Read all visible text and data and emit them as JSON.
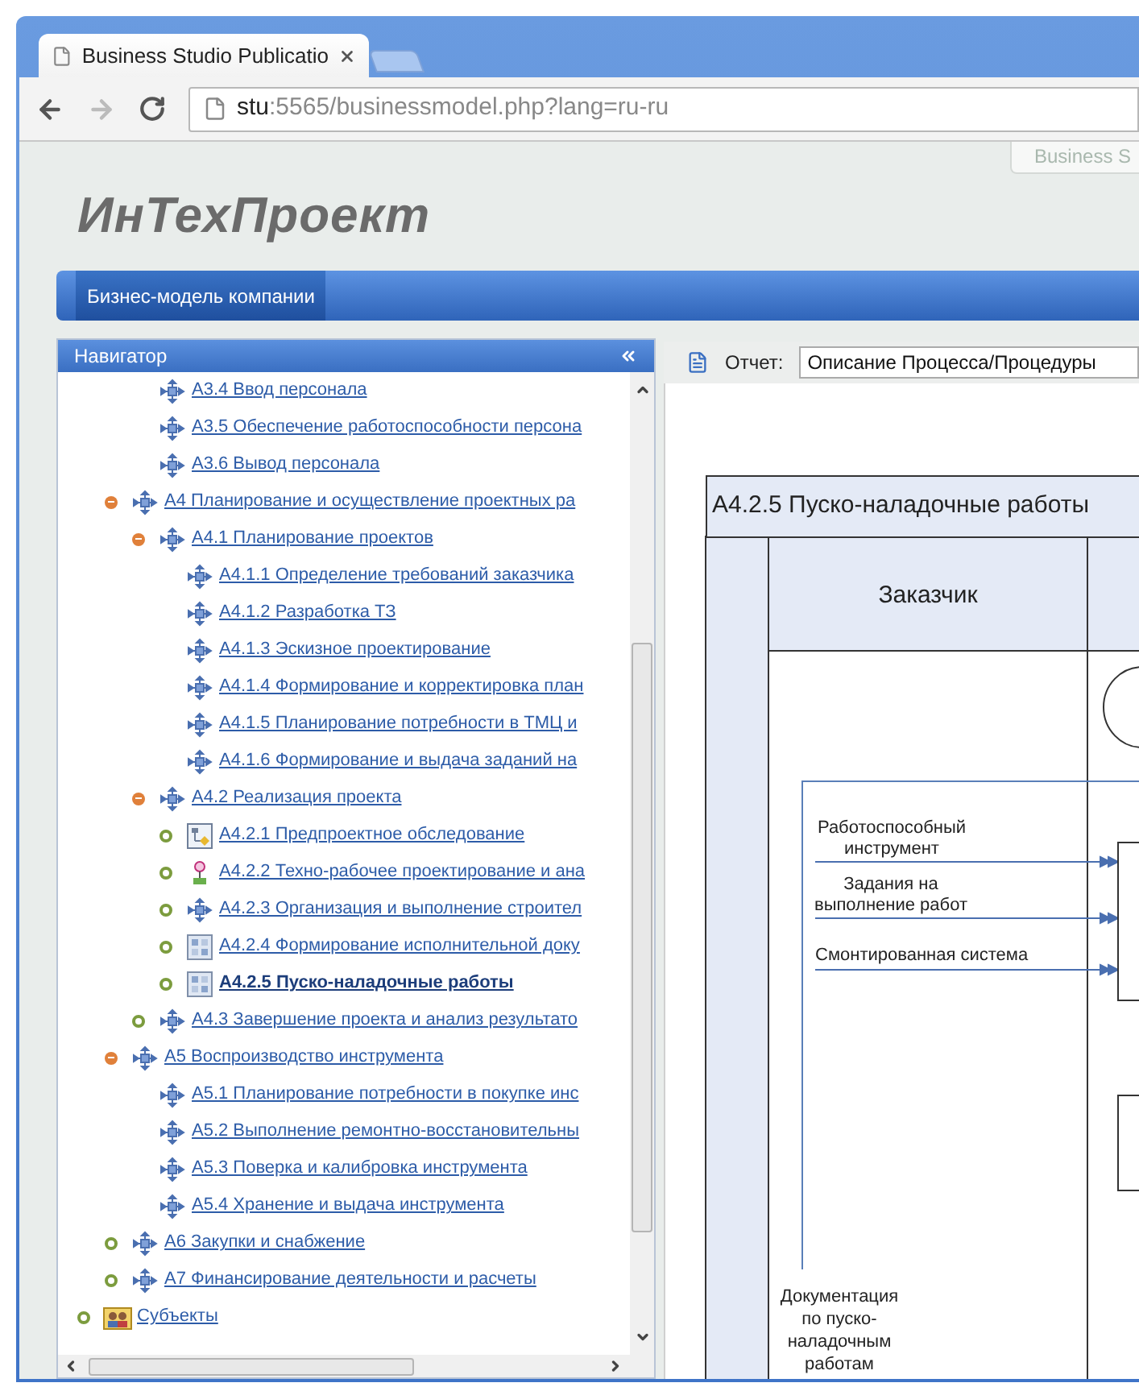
{
  "browser": {
    "tab": {
      "title": "Business Studio Publicatio"
    },
    "url": {
      "host": "stu",
      "rest": ":5565/businessmodel.php?lang=ru-ru"
    }
  },
  "header": {
    "corner_tab": "Business S",
    "logo": "ИнТехПроект"
  },
  "menu": [
    {
      "label": "Бизнес-модель компании",
      "selected": true
    }
  ],
  "navigator": {
    "title": "Навигатор",
    "tree": [
      {
        "children": [
          {
            "children": [
              {
                "label": "А3.4 Ввод персонала",
                "kind": "process",
                "selected": false
              },
              {
                "label": "А3.5 Обеспечение работоспособности персона",
                "kind": "process",
                "selected": false
              },
              {
                "label": "А3.6 Вывод персонала",
                "kind": "process",
                "selected": false
              }
            ]
          },
          {
            "label": "А4 Планирование и осуществление проектных ра",
            "kind": "process",
            "expanded": true,
            "selected": false,
            "children": [
              {
                "label": "А4.1 Планирование проектов",
                "kind": "process",
                "expanded": true,
                "selected": false,
                "children": [
                  {
                    "label": "А4.1.1 Определение требований заказчика",
                    "kind": "process",
                    "selected": false
                  },
                  {
                    "label": "А4.1.2 Разработка ТЗ",
                    "kind": "process",
                    "selected": false
                  },
                  {
                    "label": "А4.1.3 Эскизное проектирование",
                    "kind": "process",
                    "selected": false
                  },
                  {
                    "label": "А4.1.4 Формирование и корректировка план",
                    "kind": "process",
                    "selected": false
                  },
                  {
                    "label": "А4.1.5 Планирование потребности в ТМЦ и",
                    "kind": "process",
                    "selected": false
                  },
                  {
                    "label": "А4.1.6 Формирование и выдача заданий на",
                    "kind": "process",
                    "selected": false
                  }
                ]
              },
              {
                "label": "А4.2 Реализация проекта",
                "kind": "process",
                "expanded": true,
                "selected": false,
                "children": [
                  {
                    "label": "А4.2.1 Предпроектное обследование",
                    "kind": "diagram",
                    "expanded": false,
                    "selected": false
                  },
                  {
                    "label": "А4.2.2 Техно-рабочее проектирование и ана",
                    "kind": "node",
                    "expanded": false,
                    "selected": false
                  },
                  {
                    "label": "А4.2.3 Организация и выполнение строител",
                    "kind": "process",
                    "expanded": false,
                    "selected": false
                  },
                  {
                    "label": "А4.2.4 Формирование исполнительной доку",
                    "kind": "table",
                    "expanded": false,
                    "selected": false
                  },
                  {
                    "label": "А4.2.5 Пуско-наладочные работы",
                    "kind": "table",
                    "expanded": false,
                    "selected": true
                  }
                ]
              },
              {
                "label": "А4.3 Завершение проекта и анализ результато",
                "kind": "process",
                "expanded": false,
                "selected": false
              }
            ]
          },
          {
            "label": "А5 Воспроизводство инструмента",
            "kind": "process",
            "expanded": true,
            "selected": false,
            "children": [
              {
                "label": "А5.1 Планирование потребности в покупке инс",
                "kind": "process",
                "selected": false
              },
              {
                "label": "А5.2 Выполнение ремонтно-восстановительны",
                "kind": "process",
                "selected": false
              },
              {
                "label": "А5.3 Поверка и калибровка инструмента",
                "kind": "process",
                "selected": false
              },
              {
                "label": "А5.4 Хранение и выдача инструмента",
                "kind": "process",
                "selected": false
              }
            ]
          },
          {
            "label": "А6 Закупки и снабжение",
            "kind": "process",
            "expanded": false,
            "selected": false
          },
          {
            "label": "А7 Финансирование деятельности и расчеты",
            "kind": "process",
            "expanded": false,
            "selected": false
          }
        ]
      },
      {
        "label": "Субъекты",
        "kind": "people",
        "expanded": false,
        "selected": false
      }
    ]
  },
  "report": {
    "label": "Отчет:",
    "value": "Описание Процесса/Процедуры"
  },
  "diagram": {
    "title": "А4.2.5 Пуско-наладочные работы",
    "lane": "Заказчик",
    "flows": [
      "Работоспособный инструмент",
      "Задания на выполнение работ",
      "Смонтированная система"
    ],
    "note": "Документация по пуско-наладочным работам"
  }
}
